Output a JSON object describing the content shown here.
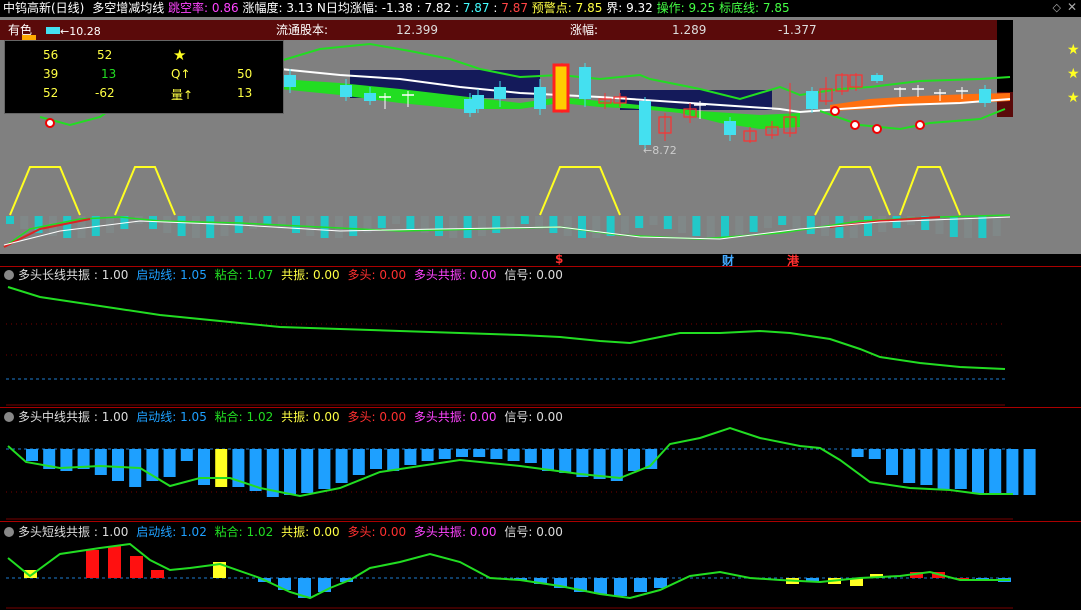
{
  "topbar": {
    "stock": "中钨高新(日线)",
    "indicator": "多空增减均线",
    "items": [
      {
        "label": "跳空率:",
        "value": "0.86",
        "lc": "#ff44ff",
        "vc": "#ff44ff"
      },
      {
        "label": "涨幅度:",
        "value": "3.13",
        "lc": "#fff",
        "vc": "#fff"
      },
      {
        "label": "N日均涨幅:",
        "value": "-1.38",
        "lc": "#fff",
        "vc": "#fff"
      },
      {
        "label": ":",
        "value": "7.82",
        "lc": "#fff",
        "vc": "#fff"
      },
      {
        "label": ":",
        "value": "7.87",
        "lc": "#fff",
        "vc": "#44ffff"
      },
      {
        "label": ":",
        "value": "7.87",
        "lc": "#fff",
        "vc": "#ff4444"
      },
      {
        "label": "预警点:",
        "value": "7.85",
        "lc": "#ffff44",
        "vc": "#ffff44"
      },
      {
        "label": "界:",
        "value": "9.32",
        "lc": "#fff",
        "vc": "#fff"
      },
      {
        "label": "操作:",
        "value": "9.25",
        "lc": "#44ff44",
        "vc": "#44ff44"
      },
      {
        "label": "标底线:",
        "value": "7.85",
        "lc": "#44ff44",
        "vc": "#44ff44"
      }
    ]
  },
  "info": {
    "label_have": "有色",
    "high_price": "10.28",
    "float_label": "流通股本:",
    "float_value": "12.399",
    "change_label": "涨幅:",
    "change_value1": "1.289",
    "change_value2": "-1.377",
    "low_price": "8.72"
  },
  "infobox": {
    "rows": [
      {
        "a": "56",
        "b": "52",
        "c": "★",
        "d": ""
      },
      {
        "a": "39",
        "b": "13",
        "c": "Q↑",
        "d": "50"
      },
      {
        "a": "52",
        "b": "-62",
        "c": "量↑",
        "d": "13"
      }
    ]
  },
  "markers": {
    "m1": "$",
    "m2": "财",
    "m3": "港"
  },
  "panels": [
    {
      "name": "多头长线共振",
      "v1": "1.00",
      "k2": "启动线",
      "v2": "1.05",
      "k3": "粘合",
      "v3": "1.07",
      "k4": "共振",
      "v4": "0.00",
      "k5": "多头",
      "v5": "0.00",
      "k6": "多头共振",
      "v6": "0.00",
      "k7": "信号",
      "v7": "0.00"
    },
    {
      "name": "多头中线共振",
      "v1": "1.00",
      "k2": "启动线",
      "v2": "1.05",
      "k3": "粘合",
      "v3": "1.02",
      "k4": "共振",
      "v4": "0.00",
      "k5": "多头",
      "v5": "0.00",
      "k6": "多头共振",
      "v6": "0.00",
      "k7": "信号",
      "v7": "0.00"
    },
    {
      "name": "多头短线共振",
      "v1": "1.00",
      "k2": "启动线",
      "v2": "1.02",
      "k3": "粘合",
      "v3": "1.02",
      "k4": "共振",
      "v4": "0.00",
      "k5": "多头",
      "v5": "0.00",
      "k6": "多头共振",
      "v6": "0.00",
      "k7": "信号",
      "v7": "0.00"
    }
  ],
  "colors": {
    "up": "#ff3030",
    "down": "#44e0f0",
    "green": "#22dd22",
    "yellow": "#ffff22",
    "blue": "#1ea0ff"
  }
}
